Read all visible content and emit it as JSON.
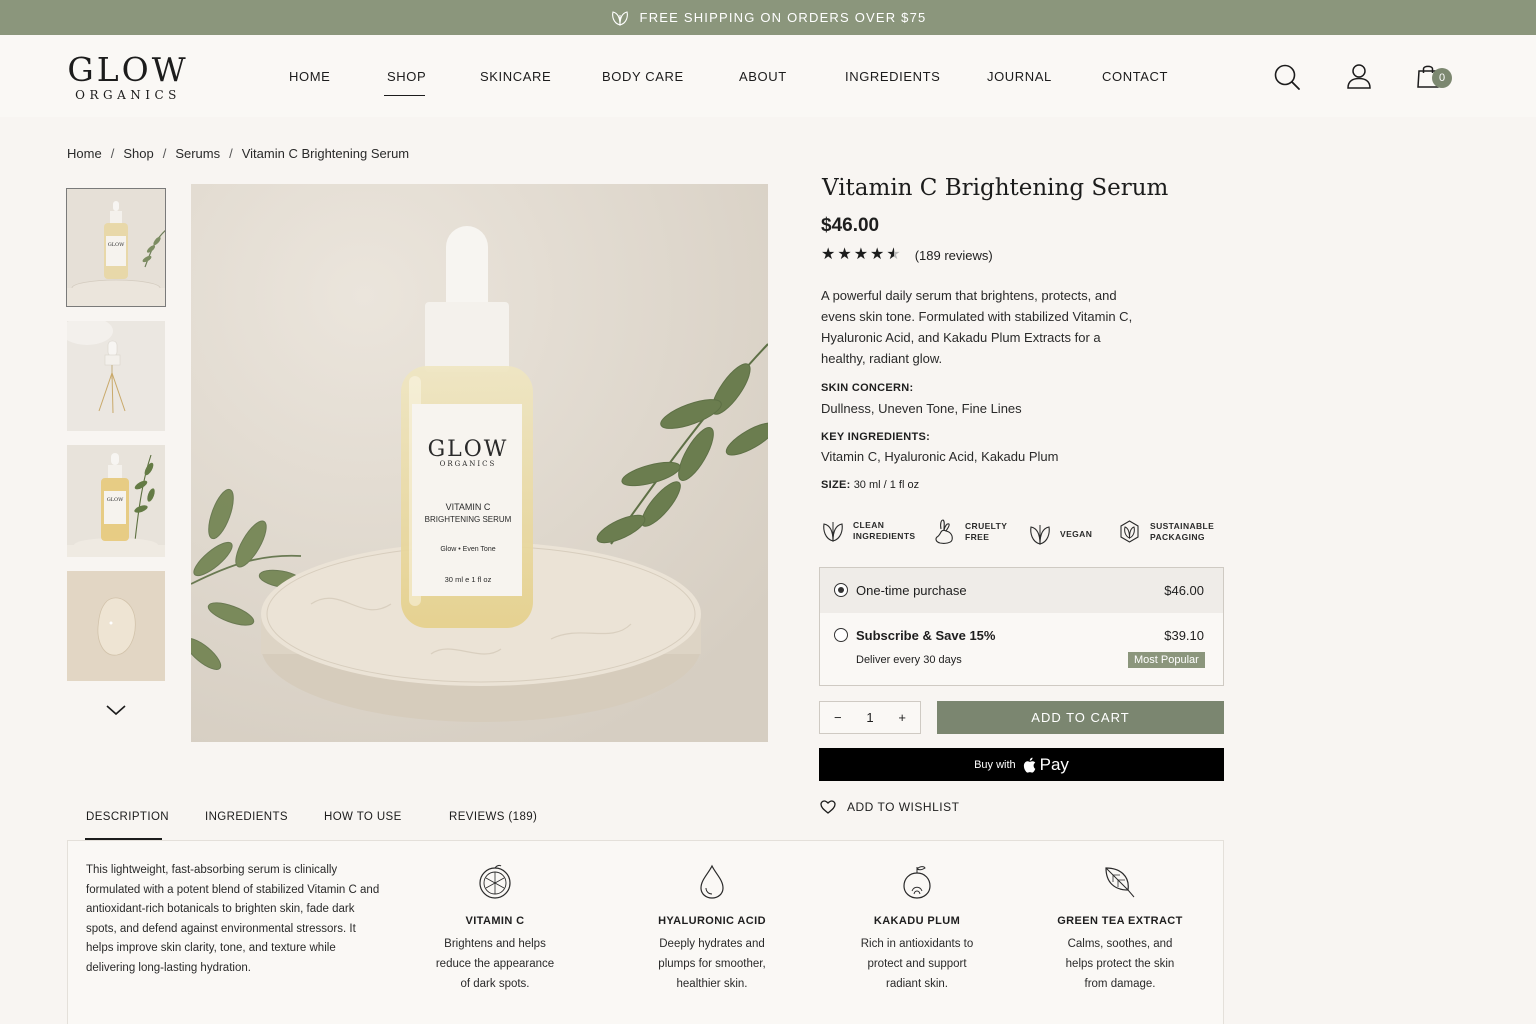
{
  "announcement": {
    "text": "FREE SHIPPING ON ORDERS OVER $75",
    "icon": "leaf-icon"
  },
  "brand": {
    "name": "GLOW",
    "tagline": "ORGANICS"
  },
  "nav": {
    "items": [
      "HOME",
      "SHOP",
      "SKINCARE",
      "BODY CARE",
      "ABOUT",
      "INGREDIENTS",
      "JOURNAL",
      "CONTACT"
    ],
    "active": "SHOP"
  },
  "header_icons": {
    "search": "search-icon",
    "account": "account-icon",
    "cart": "cart-icon",
    "cart_count": "0"
  },
  "breadcrumb": [
    "Home",
    "Shop",
    "Serums",
    "Vitamin C Brightening Serum"
  ],
  "product_image": {
    "label_brand": "GLOW",
    "label_sub": "ORGANICS",
    "label_name_1": "VITAMIN C",
    "label_name_2": "BRIGHTENING SERUM",
    "label_line": "Glow • Even Tone",
    "label_size": "30 ml e 1 fl oz"
  },
  "product": {
    "title": "Vitamin C Brightening Serum",
    "price": "$46.00",
    "rating": 4.5,
    "reviews": "(189 reviews)",
    "description": "A powerful daily serum that brightens, protects, and evens skin tone. Formulated with stabilized Vitamin C, Hyaluronic Acid, and Kakadu Plum Extracts for a healthy, radiant glow.",
    "skin_concern_label": "SKIN CONCERN:",
    "skin_concern": "Dullness, Uneven Tone, Fine Lines",
    "key_ingredients_label": "KEY INGREDIENTS:",
    "key_ingredients": "Vitamin C, Hyaluronic Acid, Kakadu Plum",
    "size_label": "SIZE:",
    "size": "30 ml / 1 fl oz"
  },
  "badges": [
    {
      "icon": "leaf-icon",
      "line1": "CLEAN",
      "line2": "INGREDIENTS"
    },
    {
      "icon": "rabbit-icon",
      "line1": "CRUELTY",
      "line2": "FREE"
    },
    {
      "icon": "leaf-icon",
      "line1": "VEGAN",
      "line2": ""
    },
    {
      "icon": "recycle-leaf-icon",
      "line1": "SUSTAINABLE",
      "line2": "PACKAGING"
    }
  ],
  "purchase_options": {
    "one_time": {
      "label": "One-time purchase",
      "price": "$46.00",
      "selected": true
    },
    "subscribe": {
      "label": "Subscribe & Save 15%",
      "price": "$39.10",
      "note": "Deliver every 30 days",
      "badge": "Most Popular",
      "selected": false
    }
  },
  "quantity": {
    "minus": "−",
    "value": "1",
    "plus": "+"
  },
  "add_to_cart": "ADD TO CART",
  "apple_pay": {
    "prefix": "Buy with",
    "brand": "Pay"
  },
  "wishlist": "ADD TO WISHLIST",
  "tabs": {
    "items": [
      "DESCRIPTION",
      "INGREDIENTS",
      "HOW TO USE",
      "REVIEWS (189)"
    ],
    "active": "DESCRIPTION"
  },
  "description_text": "This lightweight, fast-absorbing serum is clinically formulated with a potent blend of stabilized Vitamin C and antioxidant-rich botanicals to brighten skin, fade dark spots, and defend against environmental stressors. It helps improve skin clarity, tone, and texture while delivering long-lasting hydration.",
  "ingredients": [
    {
      "icon": "citrus-icon",
      "name": "VITAMIN C",
      "desc": "Brightens and helps reduce the appearance of dark spots."
    },
    {
      "icon": "droplet-icon",
      "name": "HYALURONIC ACID",
      "desc": "Deeply hydrates and plumps for smoother, healthier skin."
    },
    {
      "icon": "plum-icon",
      "name": "KAKADU PLUM",
      "desc": "Rich in antioxidants to protect and support radiant skin."
    },
    {
      "icon": "tea-leaf-icon",
      "name": "GREEN TEA EXTRACT",
      "desc": "Calms, soothes, and helps protect the skin from damage."
    }
  ],
  "colors": {
    "accent": "#8b967c",
    "button": "#7b8670",
    "background": "#f8f5f2",
    "text": "#1c1c1c"
  }
}
